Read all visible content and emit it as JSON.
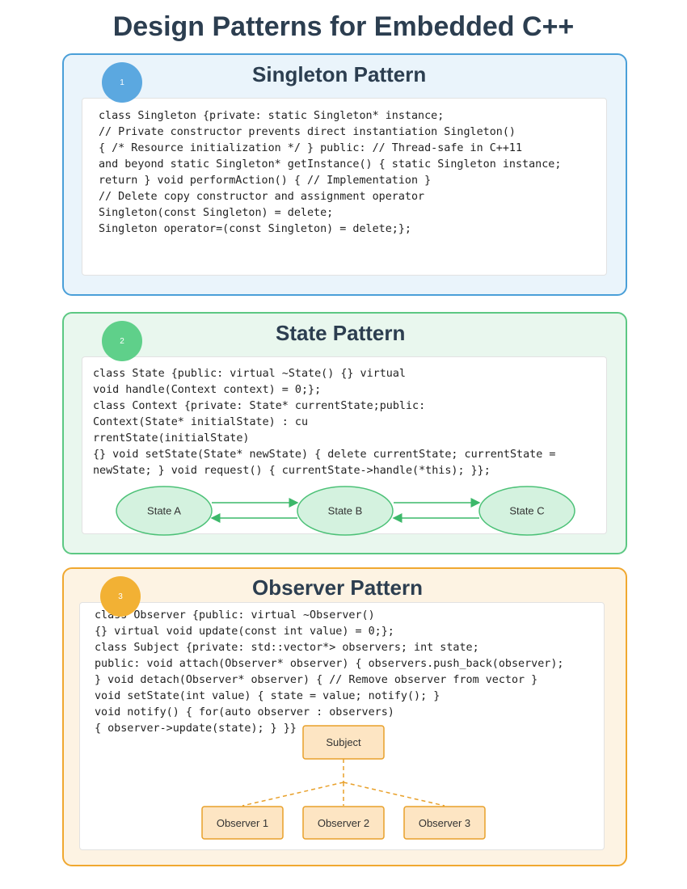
{
  "title": "Design Patterns for Embedded C++",
  "colors": {
    "singleton_accent": "#4a9fd8",
    "state_accent": "#5cc883",
    "observer_accent": "#f0a830",
    "title_text": "#2c3e50"
  },
  "sections": [
    {
      "number": "1",
      "title": "Singleton Pattern",
      "code_lines": [
        "class Singleton {private: static Singleton* instance;",
        "// Private constructor prevents direct instantiation Singleton()",
        "{ /* Resource initialization */ } public: // Thread-safe in C++11",
        "and beyond static Singleton* getInstance() { static Singleton instance;",
        "return } void performAction() { // Implementation }",
        "// Delete copy constructor and assignment operator",
        "Singleton(const Singleton) = delete;",
        "Singleton operator=(const Singleton) = delete;};"
      ]
    },
    {
      "number": "2",
      "title": "State Pattern",
      "code_lines": [
        "class State {public: virtual ~State() {} virtual",
        "void handle(Context context) = 0;};",
        "class Context {private: State* currentState;public:",
        "Context(State* initialState) : cu",
        "rrentState(initialState)",
        "{} void setState(State* newState) { delete currentState; currentState =",
        "newState; } void request() { currentState->handle(*this); }};"
      ],
      "diagram": {
        "nodes": [
          "State A",
          "State B",
          "State C"
        ]
      }
    },
    {
      "number": "3",
      "title": "Observer Pattern",
      "code_lines": [
        "class Observer {public: virtual ~Observer()",
        "{} virtual void update(const int value) = 0;};",
        "class Subject {private: std::vector*> observers; int state;",
        "public: void attach(Observer* observer) { observers.push_back(observer);",
        "} void detach(Observer* observer) { // Remove observer from vector }",
        "void setState(int value) { state = value; notify(); }",
        "void notify() { for(auto observer : observers)",
        "{ observer->update(state); } }}"
      ],
      "diagram": {
        "subject": "Subject",
        "observers": [
          "Observer 1",
          "Observer 2",
          "Observer 3"
        ]
      }
    }
  ]
}
